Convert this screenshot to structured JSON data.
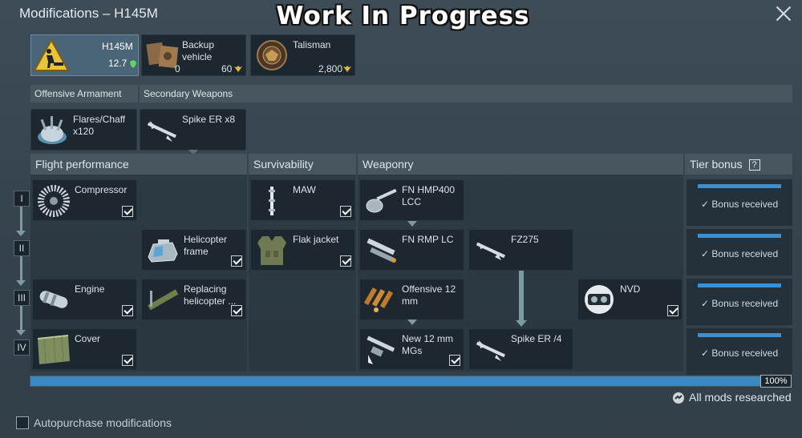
{
  "window": {
    "title": "Modifications – H145M",
    "overlay_title": "Work In Progress"
  },
  "vehicle": {
    "name": "H145M",
    "br": "12.7",
    "status_icon": "shield-icon"
  },
  "backup": {
    "label": "Backup vehicle",
    "count": "0",
    "price": "60",
    "currency_icon": "golden-eagle-icon"
  },
  "talisman": {
    "label": "Talisman",
    "price": "2,800",
    "currency_icon": "golden-eagle-icon"
  },
  "armament_headers": {
    "offensive": "Offensive Armament",
    "secondary": "Secondary Weapons"
  },
  "armament_items": {
    "flares": "Flares/Chaff x120",
    "spike": "Spike ER x8"
  },
  "columns": {
    "flight": "Flight performance",
    "survivability": "Survivability",
    "weaponry": "Weaponry",
    "tier_bonus": "Tier bonus",
    "tier_help": "?"
  },
  "tiers": [
    "I",
    "II",
    "III",
    "IV"
  ],
  "mods": {
    "compressor": "Compressor",
    "heli_frame": "Helicopter frame",
    "engine": "Engine",
    "replacing": "Replacing helicopter ...",
    "cover": "Cover",
    "maw": "MAW",
    "flak": "Flak jacket",
    "fn_hmp400": "FN HMP400 LCC",
    "fn_rmp": "FN RMP LC",
    "fz275": "FZ275",
    "offensive12": "Offensive 12 mm",
    "new12": "New 12 mm MGs",
    "spike4": "Spike ER /4",
    "nvd": "NVD"
  },
  "bonus": {
    "label": "Bonus received",
    "rows": [
      "Bonus received",
      "Bonus received",
      "Bonus received",
      "Bonus received"
    ]
  },
  "progress": {
    "percent_label": "100%",
    "fraction": 1.0,
    "status": "All mods researched"
  },
  "autopurchase": {
    "label": "Autopurchase modifications",
    "checked": false
  },
  "colors": {
    "accent": "#3a89c3",
    "card_bg": "#1c272f",
    "header_bg": "#48565f"
  }
}
